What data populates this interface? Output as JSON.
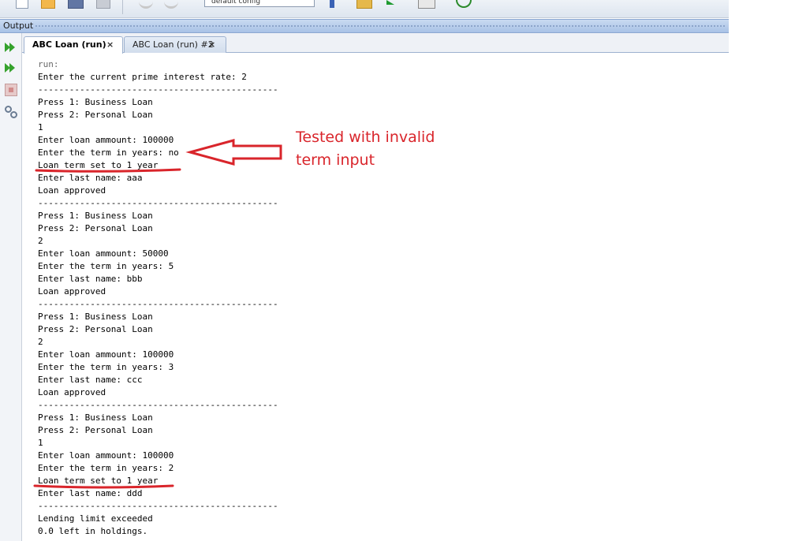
{
  "toolbar": {
    "config_select": "default config"
  },
  "output_panel": {
    "title": "Output"
  },
  "tabs": [
    {
      "label": "ABC Loan (run)",
      "close": "×",
      "active": true
    },
    {
      "label": "ABC Loan (run) #2",
      "close": "×",
      "active": false
    }
  ],
  "console_lines": [
    "run:",
    "Enter the current prime interest rate: 2",
    "----------------------------------------------",
    "Press 1: Business Loan",
    "Press 2: Personal Loan",
    "1",
    "Enter loan ammount: 100000",
    "Enter the term in years: no",
    "Loan term set to 1 year",
    "Enter last name: aaa",
    "Loan approved",
    "----------------------------------------------",
    "Press 1: Business Loan",
    "Press 2: Personal Loan",
    "2",
    "Enter loan ammount: 50000",
    "Enter the term in years: 5",
    "Enter last name: bbb",
    "Loan approved",
    "----------------------------------------------",
    "Press 1: Business Loan",
    "Press 2: Personal Loan",
    "2",
    "Enter loan ammount: 100000",
    "Enter the term in years: 3",
    "Enter last name: ccc",
    "Loan approved",
    "----------------------------------------------",
    "Press 1: Business Loan",
    "Press 2: Personal Loan",
    "1",
    "Enter loan ammount: 100000",
    "Enter the term in years: 2",
    "Loan term set to 1 year",
    "Enter last name: ddd",
    "----------------------------------------------",
    "Lending limit exceeded",
    "0.0 left in holdings."
  ],
  "annotation": {
    "line1": "Tested with invalid",
    "line2": "term input",
    "color": "#d9252b"
  },
  "side_icons": [
    "rerun-icon",
    "rerun-failed-icon",
    "stop-icon",
    "settings-icon"
  ]
}
